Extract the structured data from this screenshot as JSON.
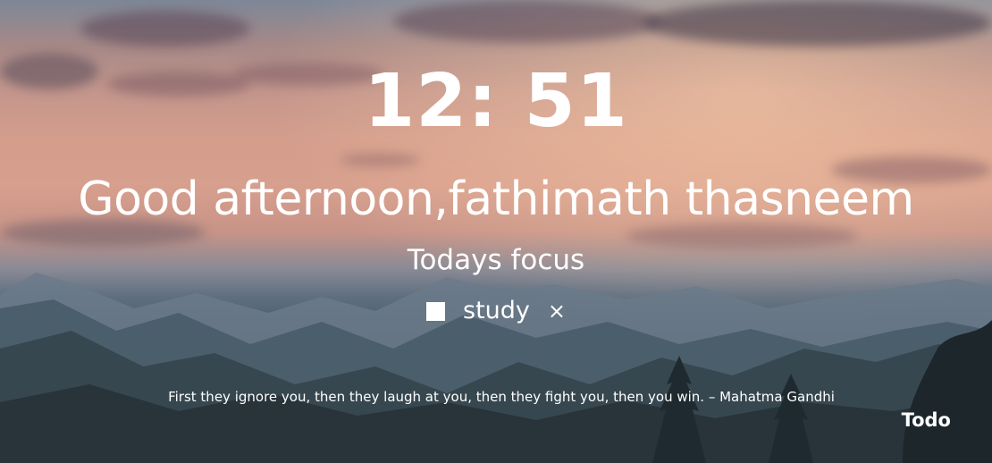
{
  "clock": {
    "time": "12: 51"
  },
  "greeting": {
    "text": "Good afternoon,fathimath thasneem"
  },
  "focus": {
    "title": "Todays focus",
    "task": "study",
    "checked": false,
    "remove_icon": "×"
  },
  "quote": {
    "text": "First they ignore you, then they laugh at you, then they fight you, then you win. – Mahatma Gandhi"
  },
  "todo": {
    "label": "Todo"
  },
  "colors": {
    "text": "#ffffff",
    "sky_top": "#7d8798",
    "sky_glow": "#d79f8d",
    "mountains": "#3f5260"
  }
}
